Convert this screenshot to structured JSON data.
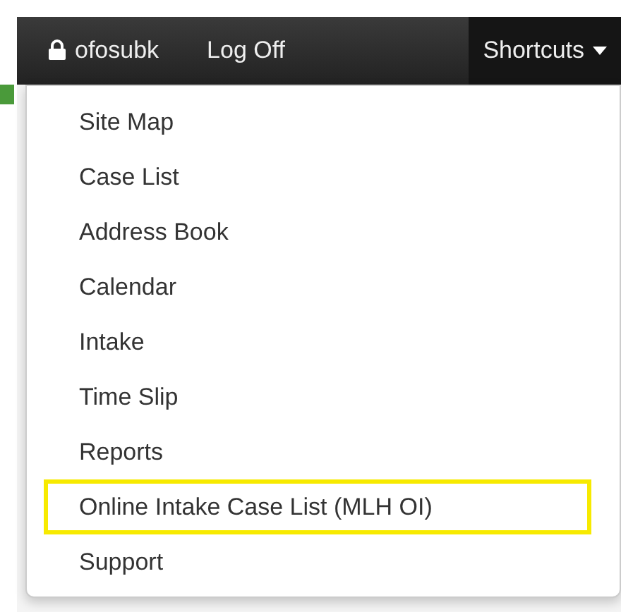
{
  "navbar": {
    "items": [
      {
        "label": "ofosubk",
        "kind": "user",
        "selected": false
      },
      {
        "label": "Log Off",
        "kind": "link",
        "selected": false
      },
      {
        "label": "Shortcuts",
        "kind": "dropdown",
        "selected": true
      }
    ]
  },
  "menu": {
    "items": [
      {
        "label": "Site Map",
        "highlighted": false
      },
      {
        "label": "Case List",
        "highlighted": false
      },
      {
        "label": "Address Book",
        "highlighted": false
      },
      {
        "label": "Calendar",
        "highlighted": false
      },
      {
        "label": "Intake",
        "highlighted": false
      },
      {
        "label": "Time Slip",
        "highlighted": false
      },
      {
        "label": "Reports",
        "highlighted": false
      },
      {
        "label": "Online Intake Case List (MLH OI)",
        "highlighted": true
      },
      {
        "label": "Support",
        "highlighted": false
      }
    ]
  }
}
